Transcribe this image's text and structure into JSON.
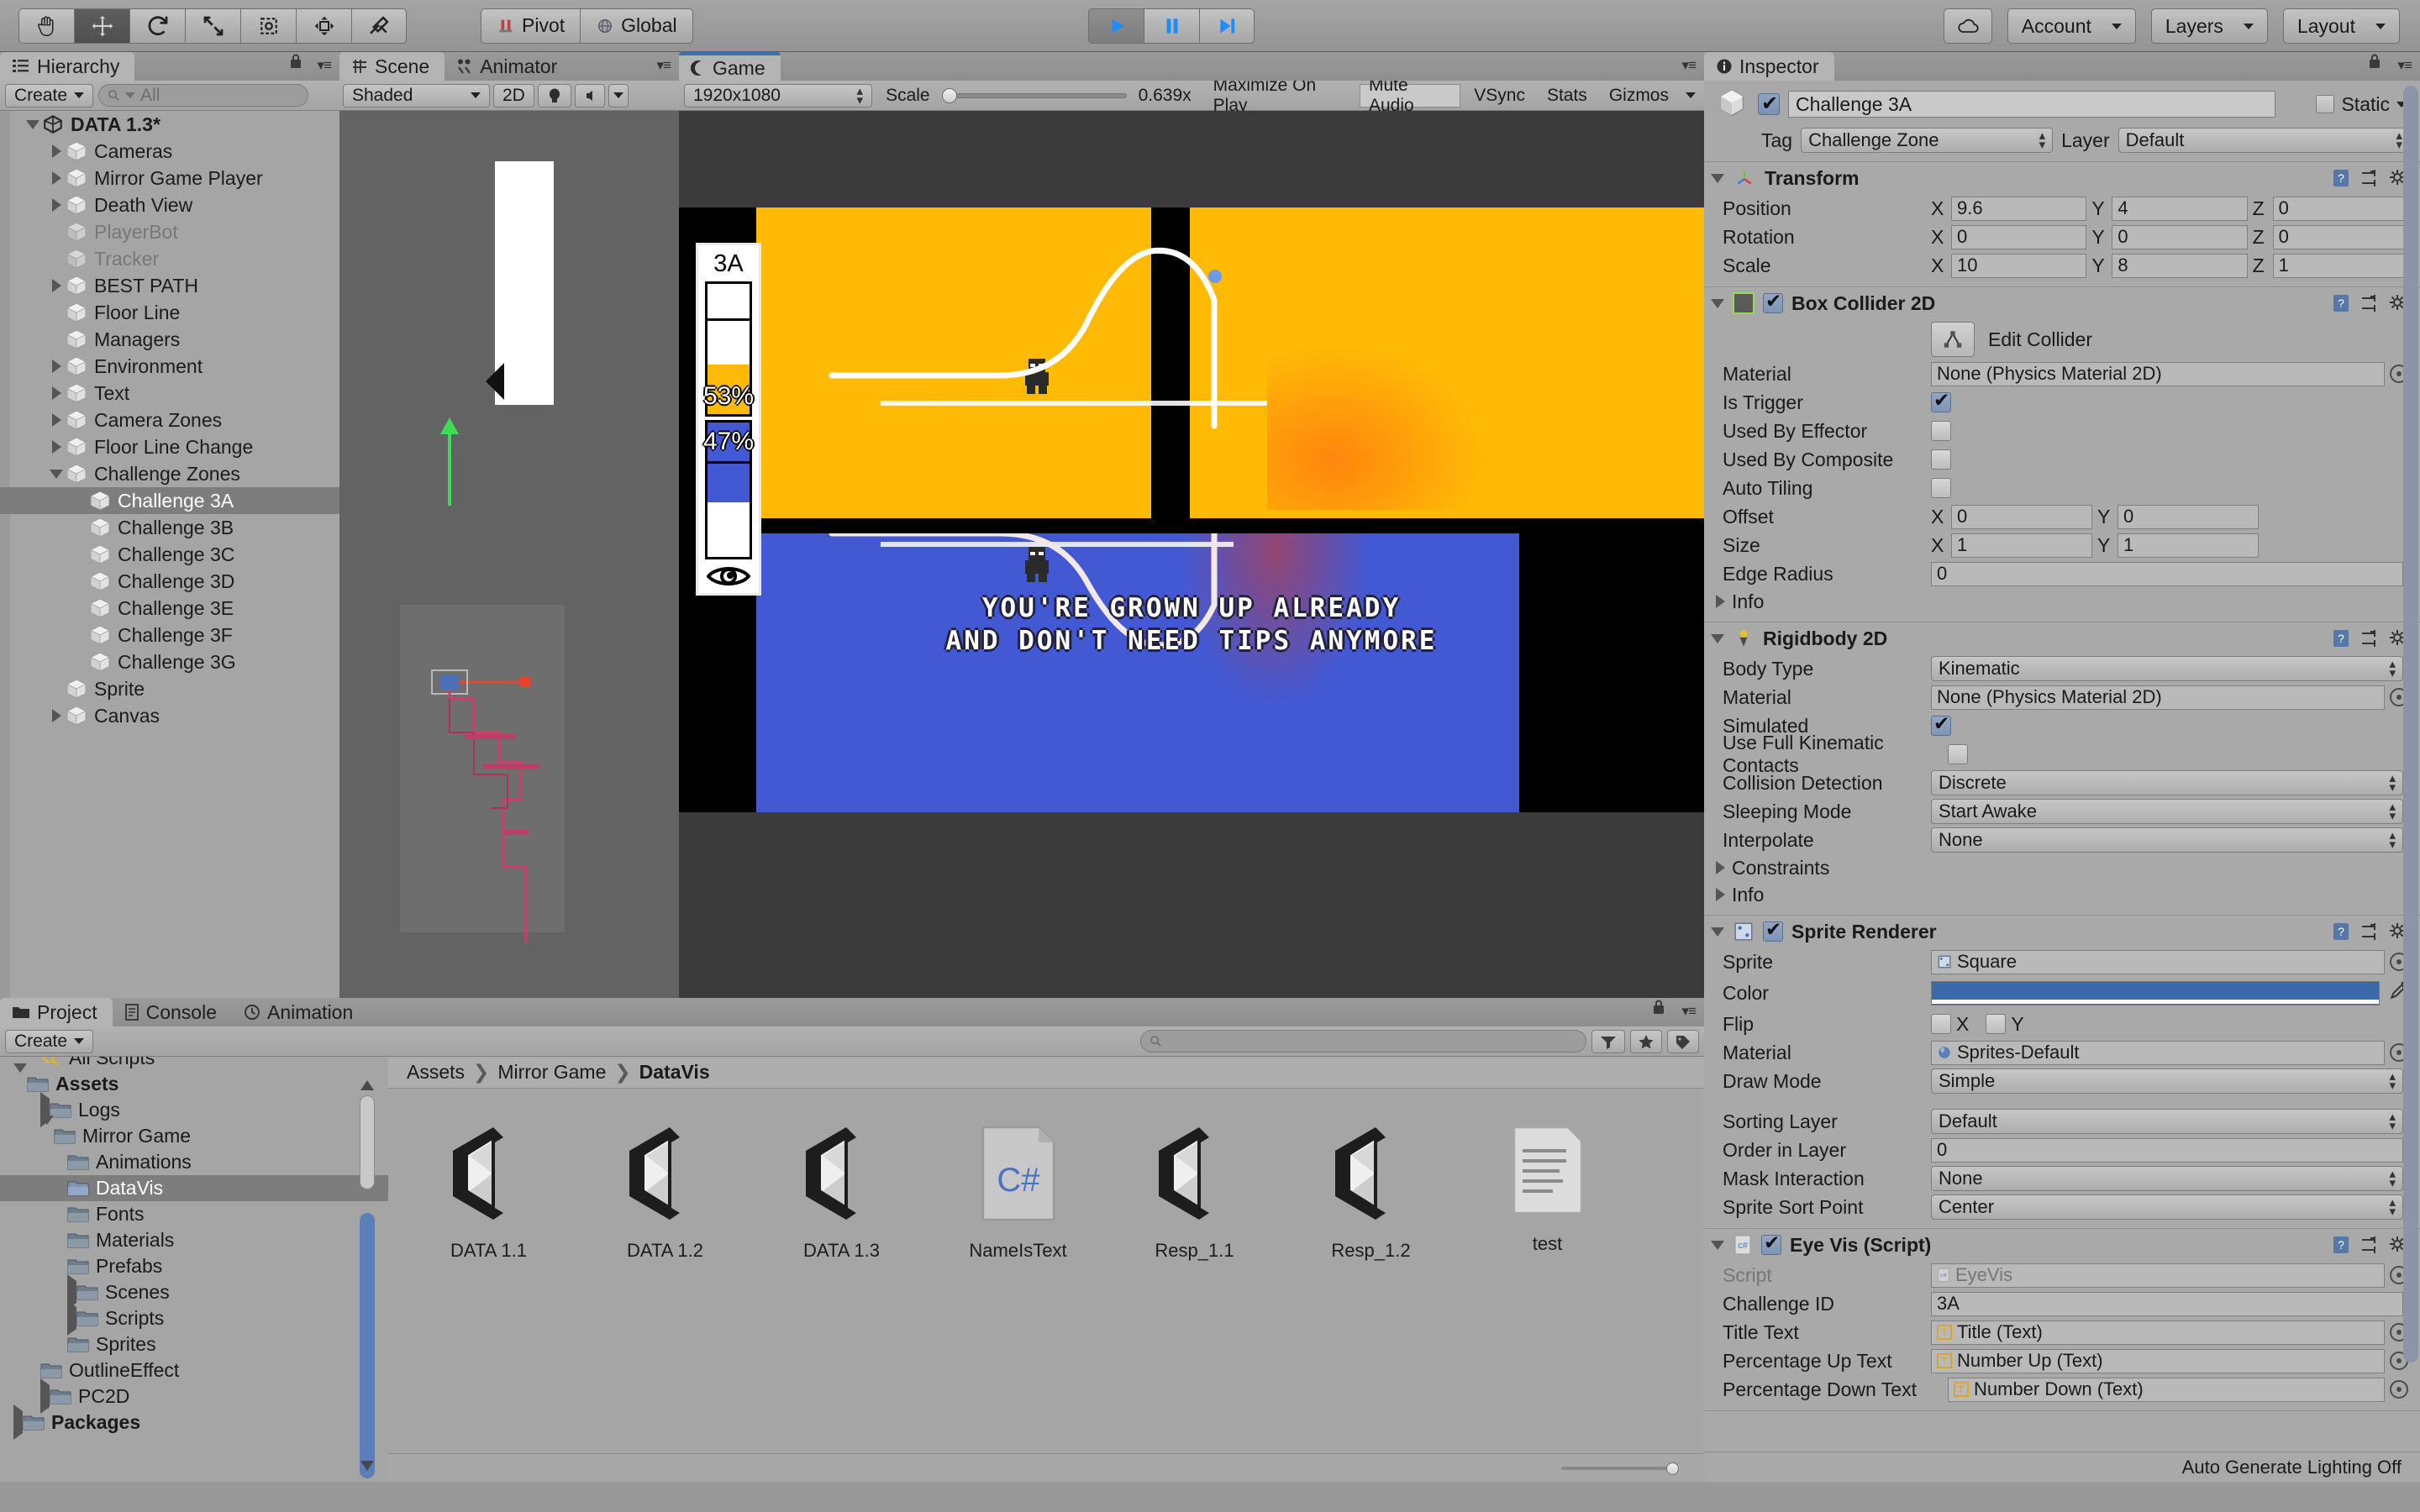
{
  "toolbar": {
    "tools": [
      "hand-tool",
      "move-tool",
      "rotate-tool",
      "scale-tool",
      "rect-tool",
      "transform-tool",
      "custom-tool"
    ],
    "pivot_label": "Pivot",
    "global_label": "Global",
    "play_label": "play",
    "pause_label": "pause",
    "step_label": "step",
    "cloud_label": "cloud",
    "account_label": "Account",
    "layers_label": "Layers",
    "layout_label": "Layout"
  },
  "hierarchy": {
    "tab": "Hierarchy",
    "create_label": "Create",
    "search_placeholder": "All",
    "items": [
      {
        "label": "DATA 1.3*",
        "depth": 0,
        "expanded": true,
        "bold": true,
        "dim": false,
        "selected": false,
        "icon": "unity-scene-icon"
      },
      {
        "label": "Cameras",
        "depth": 1,
        "expanded": false,
        "bold": false,
        "dim": false,
        "selected": false,
        "icon": "gameobject-icon"
      },
      {
        "label": "Mirror Game Player",
        "depth": 1,
        "expanded": false,
        "bold": false,
        "dim": false,
        "selected": false,
        "icon": "gameobject-icon"
      },
      {
        "label": "Death View",
        "depth": 1,
        "expanded": false,
        "bold": false,
        "dim": false,
        "selected": false,
        "icon": "gameobject-icon"
      },
      {
        "label": "PlayerBot",
        "depth": 1,
        "expanded": null,
        "bold": false,
        "dim": true,
        "selected": false,
        "icon": "gameobject-icon"
      },
      {
        "label": "Tracker",
        "depth": 1,
        "expanded": null,
        "bold": false,
        "dim": true,
        "selected": false,
        "icon": "gameobject-icon"
      },
      {
        "label": "BEST PATH",
        "depth": 1,
        "expanded": false,
        "bold": false,
        "dim": false,
        "selected": false,
        "icon": "gameobject-icon"
      },
      {
        "label": "Floor Line",
        "depth": 1,
        "expanded": null,
        "bold": false,
        "dim": false,
        "selected": false,
        "icon": "gameobject-icon"
      },
      {
        "label": "Managers",
        "depth": 1,
        "expanded": null,
        "bold": false,
        "dim": false,
        "selected": false,
        "icon": "gameobject-icon"
      },
      {
        "label": "Environment",
        "depth": 1,
        "expanded": false,
        "bold": false,
        "dim": false,
        "selected": false,
        "icon": "gameobject-icon"
      },
      {
        "label": "Text",
        "depth": 1,
        "expanded": false,
        "bold": false,
        "dim": false,
        "selected": false,
        "icon": "gameobject-icon"
      },
      {
        "label": "Camera Zones",
        "depth": 1,
        "expanded": false,
        "bold": false,
        "dim": false,
        "selected": false,
        "icon": "gameobject-icon"
      },
      {
        "label": "Floor Line Change",
        "depth": 1,
        "expanded": false,
        "bold": false,
        "dim": false,
        "selected": false,
        "icon": "gameobject-icon"
      },
      {
        "label": "Challenge Zones",
        "depth": 1,
        "expanded": true,
        "bold": false,
        "dim": false,
        "selected": false,
        "icon": "gameobject-icon"
      },
      {
        "label": "Challenge 3A",
        "depth": 2,
        "expanded": null,
        "bold": false,
        "dim": false,
        "selected": true,
        "icon": "gameobject-icon"
      },
      {
        "label": "Challenge 3B",
        "depth": 2,
        "expanded": null,
        "bold": false,
        "dim": false,
        "selected": false,
        "icon": "gameobject-icon"
      },
      {
        "label": "Challenge 3C",
        "depth": 2,
        "expanded": null,
        "bold": false,
        "dim": false,
        "selected": false,
        "icon": "gameobject-icon"
      },
      {
        "label": "Challenge 3D",
        "depth": 2,
        "expanded": null,
        "bold": false,
        "dim": false,
        "selected": false,
        "icon": "gameobject-icon"
      },
      {
        "label": "Challenge 3E",
        "depth": 2,
        "expanded": null,
        "bold": false,
        "dim": false,
        "selected": false,
        "icon": "gameobject-icon"
      },
      {
        "label": "Challenge 3F",
        "depth": 2,
        "expanded": null,
        "bold": false,
        "dim": false,
        "selected": false,
        "icon": "gameobject-icon"
      },
      {
        "label": "Challenge 3G",
        "depth": 2,
        "expanded": null,
        "bold": false,
        "dim": false,
        "selected": false,
        "icon": "gameobject-icon"
      },
      {
        "label": "Sprite",
        "depth": 1,
        "expanded": null,
        "bold": false,
        "dim": false,
        "selected": false,
        "icon": "gameobject-icon"
      },
      {
        "label": "Canvas",
        "depth": 1,
        "expanded": false,
        "bold": false,
        "dim": false,
        "selected": false,
        "icon": "gameobject-icon"
      }
    ]
  },
  "scene": {
    "tabs": [
      {
        "label": "Scene",
        "icon": "scene-grid-icon",
        "active": true
      },
      {
        "label": "Animator",
        "icon": "animator-icon",
        "active": false
      }
    ],
    "shading_mode": "Shaded",
    "mode_2d": "2D",
    "light_icon": "lighting-icon",
    "audio_icon": "audio-icon"
  },
  "game": {
    "tab": "Game",
    "resolution": "1920x1080",
    "scale_label": "Scale",
    "scale_value": "0.639x",
    "maximize_label": "Maximize On Play",
    "mute_label": "Mute Audio",
    "vsync_label": "VSync",
    "stats_label": "Stats",
    "gizmos_label": "Gizmos",
    "datavis": {
      "title": "3A",
      "up_percent": "53%",
      "down_percent": "47%",
      "eye_icon": "eye-icon",
      "up_color": "#FFBA06",
      "down_color": "#4359D4"
    },
    "message_line1": "YOU'RE GROWN UP ALREADY",
    "message_line2": "AND DON'T NEED TIPS ANYMORE"
  },
  "project": {
    "tabs": [
      {
        "label": "Project",
        "icon": "folder-icon",
        "active": true
      },
      {
        "label": "Console",
        "icon": "console-icon",
        "active": false
      },
      {
        "label": "Animation",
        "icon": "clock-icon",
        "active": false
      }
    ],
    "create_label": "Create",
    "search_placeholder": "",
    "tree": [
      {
        "label": "All Scripts",
        "depth": 1,
        "expanded": null,
        "bold": false,
        "selected": false,
        "icon": "search-folder-icon"
      },
      {
        "label": "Assets",
        "depth": 0,
        "expanded": true,
        "bold": true,
        "selected": false,
        "icon": "folder-icon"
      },
      {
        "label": "Logs",
        "depth": 1,
        "expanded": false,
        "bold": false,
        "selected": false,
        "icon": "folder-icon"
      },
      {
        "label": "Mirror Game",
        "depth": 1,
        "expanded": true,
        "bold": false,
        "selected": false,
        "icon": "folder-icon"
      },
      {
        "label": "Animations",
        "depth": 2,
        "expanded": null,
        "bold": false,
        "selected": false,
        "icon": "folder-icon"
      },
      {
        "label": "DataVis",
        "depth": 2,
        "expanded": null,
        "bold": false,
        "selected": true,
        "icon": "folder-icon"
      },
      {
        "label": "Fonts",
        "depth": 2,
        "expanded": null,
        "bold": false,
        "selected": false,
        "icon": "folder-icon"
      },
      {
        "label": "Materials",
        "depth": 2,
        "expanded": null,
        "bold": false,
        "selected": false,
        "icon": "folder-icon"
      },
      {
        "label": "Prefabs",
        "depth": 2,
        "expanded": null,
        "bold": false,
        "selected": false,
        "icon": "folder-icon"
      },
      {
        "label": "Scenes",
        "depth": 2,
        "expanded": false,
        "bold": false,
        "selected": false,
        "icon": "folder-icon"
      },
      {
        "label": "Scripts",
        "depth": 2,
        "expanded": false,
        "bold": false,
        "selected": false,
        "icon": "folder-icon"
      },
      {
        "label": "Sprites",
        "depth": 2,
        "expanded": null,
        "bold": false,
        "selected": false,
        "icon": "folder-icon"
      },
      {
        "label": "OutlineEffect",
        "depth": 1,
        "expanded": null,
        "bold": false,
        "selected": false,
        "icon": "folder-icon"
      },
      {
        "label": "PC2D",
        "depth": 1,
        "expanded": false,
        "bold": false,
        "selected": false,
        "icon": "folder-icon"
      },
      {
        "label": "Packages",
        "depth": 0,
        "expanded": false,
        "bold": true,
        "selected": false,
        "icon": "folder-icon"
      }
    ],
    "breadcrumb": [
      "Assets",
      "Mirror Game",
      "DataVis"
    ],
    "assets": [
      {
        "name": "DATA 1.1",
        "icon": "unity-prefab-icon"
      },
      {
        "name": "DATA 1.2",
        "icon": "unity-prefab-icon"
      },
      {
        "name": "DATA 1.3",
        "icon": "unity-prefab-icon"
      },
      {
        "name": "NameIsText",
        "icon": "csharp-script-icon"
      },
      {
        "name": "Resp_1.1",
        "icon": "unity-prefab-icon"
      },
      {
        "name": "Resp_1.2",
        "icon": "unity-prefab-icon"
      },
      {
        "name": "test",
        "icon": "text-asset-icon"
      }
    ]
  },
  "inspector": {
    "tab": "Inspector",
    "object_name": "Challenge 3A",
    "object_enabled": true,
    "static_label": "Static",
    "tag_label": "Tag",
    "tag_value": "Challenge Zone",
    "layer_label": "Layer",
    "layer_value": "Default",
    "transform": {
      "title": "Transform",
      "position_label": "Position",
      "position": {
        "x": "9.6",
        "y": "4",
        "z": "0"
      },
      "rotation_label": "Rotation",
      "rotation": {
        "x": "0",
        "y": "0",
        "z": "0"
      },
      "scale_label": "Scale",
      "scale": {
        "x": "10",
        "y": "8",
        "z": "1"
      }
    },
    "box_collider": {
      "title": "Box Collider 2D",
      "enabled": true,
      "edit_collider_label": "Edit Collider",
      "material_label": "Material",
      "material_value": "None (Physics Material 2D)",
      "is_trigger_label": "Is Trigger",
      "is_trigger": true,
      "used_by_effector_label": "Used By Effector",
      "used_by_effector": false,
      "used_by_composite_label": "Used By Composite",
      "used_by_composite": false,
      "auto_tiling_label": "Auto Tiling",
      "auto_tiling": false,
      "offset_label": "Offset",
      "offset": {
        "x": "0",
        "y": "0"
      },
      "size_label": "Size",
      "size": {
        "x": "1",
        "y": "1"
      },
      "edge_radius_label": "Edge Radius",
      "edge_radius": "0",
      "info_label": "Info"
    },
    "rigidbody": {
      "title": "Rigidbody 2D",
      "body_type_label": "Body Type",
      "body_type": "Kinematic",
      "material_label": "Material",
      "material_value": "None (Physics Material 2D)",
      "simulated_label": "Simulated",
      "simulated": true,
      "full_kinematic_label": "Use Full Kinematic Contacts",
      "full_kinematic": false,
      "collision_detection_label": "Collision Detection",
      "collision_detection": "Discrete",
      "sleeping_mode_label": "Sleeping Mode",
      "sleeping_mode": "Start Awake",
      "interpolate_label": "Interpolate",
      "interpolate": "None",
      "constraints_label": "Constraints",
      "info_label": "Info"
    },
    "sprite_renderer": {
      "title": "Sprite Renderer",
      "enabled": true,
      "sprite_label": "Sprite",
      "sprite_value": "Square",
      "color_label": "Color",
      "color_value": "#3B68A8",
      "flip_label": "Flip",
      "flip_x_label": "X",
      "flip_y_label": "Y",
      "flip_x": false,
      "flip_y": false,
      "material_label": "Material",
      "material_value": "Sprites-Default",
      "draw_mode_label": "Draw Mode",
      "draw_mode": "Simple",
      "sorting_layer_label": "Sorting Layer",
      "sorting_layer": "Default",
      "order_in_layer_label": "Order in Layer",
      "order_in_layer": "0",
      "mask_interaction_label": "Mask Interaction",
      "mask_interaction": "None",
      "sprite_sort_point_label": "Sprite Sort Point",
      "sprite_sort_point": "Center"
    },
    "eye_vis": {
      "title": "Eye Vis (Script)",
      "enabled": true,
      "script_label": "Script",
      "script_value": "EyeVis",
      "challenge_id_label": "Challenge ID",
      "challenge_id": "3A",
      "title_text_label": "Title Text",
      "title_text": "Title (Text)",
      "percentage_up_label": "Percentage Up Text",
      "percentage_up": "Number Up (Text)",
      "percentage_down_label": "Percentage Down Text",
      "percentage_down": "Number Down (Text)"
    },
    "status": "Auto Generate Lighting Off"
  }
}
